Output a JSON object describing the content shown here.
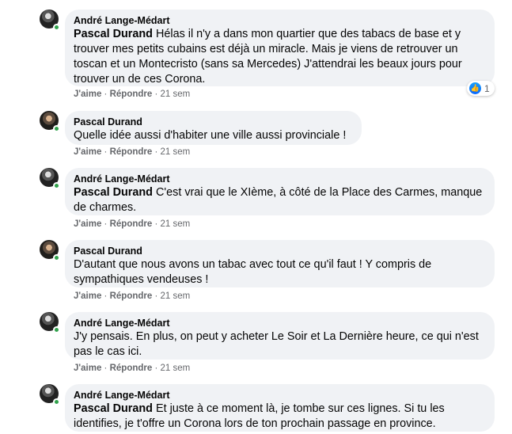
{
  "comments": [
    {
      "author": "André Lange-Médart",
      "mention": "Pascal Durand",
      "text": " Hélas il n'y a dans mon quartier que des tabacs de base et y trouver mes petits cubains est déjà un miracle. Mais je viens de retrouver un toscan et un Montecristo (sans sa Mercedes) J'attendrai les beaux jours pour trouver un de ces Corona.",
      "like_label": "J'aime",
      "reply_label": "Répondre",
      "time": "21 sem",
      "reaction_count": "1"
    },
    {
      "author": "Pascal Durand",
      "text": "Quelle idée aussi d'habiter une ville aussi provinciale !",
      "like_label": "J'aime",
      "reply_label": "Répondre",
      "time": "21 sem"
    },
    {
      "author": "André Lange-Médart",
      "mention": "Pascal Durand",
      "text": " C'est vrai que le XIème, à côté de la Place des Carmes, manque de charmes.",
      "like_label": "J'aime",
      "reply_label": "Répondre",
      "time": "21 sem"
    },
    {
      "author": "Pascal Durand",
      "text": "D'autant que nous avons un tabac avec tout ce qu'il faut ! Y compris de sympathiques vendeuses !",
      "like_label": "J'aime",
      "reply_label": "Répondre",
      "time": "21 sem"
    },
    {
      "author": "André Lange-Médart",
      "text": "J'y pensais. En plus, on peut y acheter Le Soir et La Dernière heure, ce qui n'est pas le cas ici.",
      "like_label": "J'aime",
      "reply_label": "Répondre",
      "time": "21 sem"
    },
    {
      "author": "André Lange-Médart",
      "mention": "Pascal Durand",
      "text": " Et juste à ce moment là, je tombe sur ces lignes. Si tu les identifies, je t'offre un Corona lors de ton prochain passage en province."
    }
  ],
  "separator": "·",
  "colors": {
    "bubble": "#f0f2f5",
    "online": "#31a24c",
    "meta": "#65676b",
    "like_blue": "#0866ff"
  }
}
